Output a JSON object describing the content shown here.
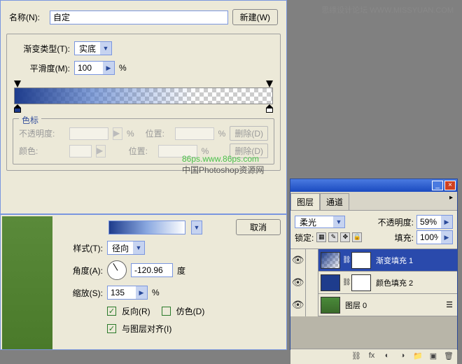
{
  "watermark": {
    "top": "思缘设计论坛  WWW.MISSYUAN.COM"
  },
  "gradient_dialog": {
    "name_label": "名称(N):",
    "name_value": "自定",
    "new_btn": "新建(W)",
    "type_label": "渐变类型(T):",
    "type_value": "实底",
    "smooth_label": "平滑度(M):",
    "smooth_value": "100",
    "percent": "%",
    "stops": {
      "legend": "色标",
      "opacity_label": "不透明度:",
      "position_label": "位置:",
      "delete_btn": "删除(D)",
      "color_label": "颜色:"
    }
  },
  "fill_dialog": {
    "cancel_btn": "取消",
    "style_label": "样式(T):",
    "style_value": "径向",
    "angle_label": "角度(A):",
    "angle_value": "-120.96",
    "angle_unit": "度",
    "scale_label": "缩放(S):",
    "scale_value": "135",
    "percent": "%",
    "reverse_label": "反向(R)",
    "dither_label": "仿色(D)",
    "align_label": "与图层对齐(I)"
  },
  "layers": {
    "tab1": "图层",
    "tab2": "通道",
    "blend_value": "柔光",
    "opacity_label": "不透明度:",
    "opacity_value": "59%",
    "lock_label": "锁定:",
    "fill_label": "填充:",
    "fill_value": "100%",
    "items": [
      {
        "name": "渐变填充 1"
      },
      {
        "name": "颜色填充 2"
      },
      {
        "name": "图层 0"
      }
    ]
  },
  "logo": {
    "line1": "86ps.www.86ps.com",
    "line2": "中国Photoshop资源网"
  }
}
